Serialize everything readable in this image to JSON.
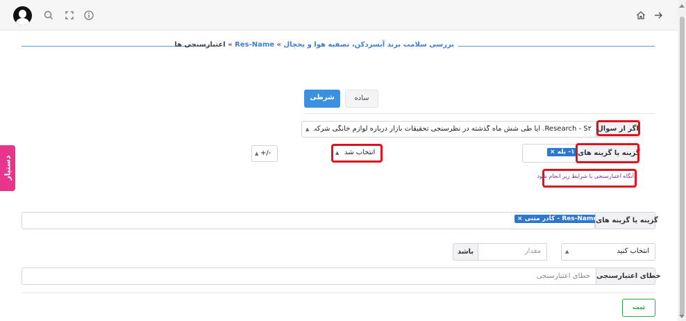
{
  "topbar": {
    "icons": [
      "user-avatar",
      "search-icon",
      "fullscreen-icon",
      "info-icon",
      "home-icon",
      "arrow-right-icon"
    ]
  },
  "breadcrumb": {
    "item1": "بررسی سلامت برند آبسردکن، تصفیه هوا و یخچال",
    "sep1": "»",
    "item2": "Res-Name",
    "sep2": "»",
    "item3": "اعتبارسنجی ها"
  },
  "tabs": {
    "conditional": "شرطی",
    "simple": "ساده"
  },
  "side_tab": {
    "label": "دستیار"
  },
  "condition": {
    "if_question_label": "اگر از سوال",
    "question_value": "Res​earch - S۲. آیا طی شش ماه گذشته در نظرسنجی تحقیقات بازار درباره لوازم خانگی شرکت کرده اید؟",
    "option_label": "گزینه یا گزینه های",
    "option_chip": "۱- بله ×",
    "selected_select": "انتخاب شد",
    "sign_select": "+/-",
    "then_note": "آنگاه اعتبارسنجی با شرایط زیر انجام شود"
  },
  "target": {
    "options_label": "گزینه یا گزینه های",
    "options_chip": "Res-Name1 - کادر متنی ×",
    "choose_select": "انتخاب کنید",
    "value_placeholder": "مقدار",
    "is_addon": "باشد",
    "error_label": "خطای اعتبارسنجی",
    "error_placeholder": "خطای اعتبارسنجی"
  },
  "submit": {
    "label": "ثبت"
  },
  "colors": {
    "primary": "#3d8fe0",
    "success": "#28a745",
    "highlight": "#e0101e",
    "side_tab": "#e7358b"
  }
}
